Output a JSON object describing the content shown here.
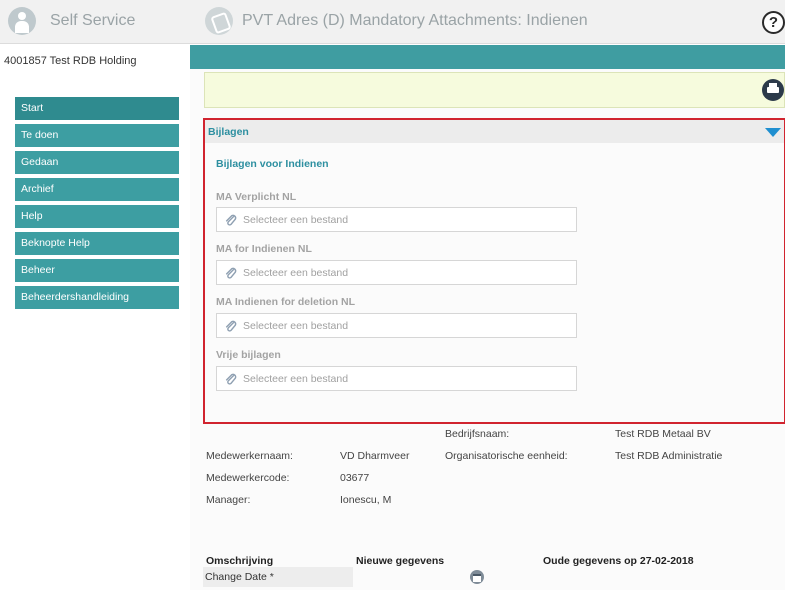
{
  "app": {
    "title": "Self Service",
    "page_title": "PVT Adres (D) Mandatory Attachments: Indienen",
    "help_label": "?"
  },
  "sidebar": {
    "company": "4001857 Test RDB Holding",
    "items": [
      {
        "label": "Start"
      },
      {
        "label": "Te doen"
      },
      {
        "label": "Gedaan"
      },
      {
        "label": "Archief"
      },
      {
        "label": "Help"
      },
      {
        "label": "Beknopte Help"
      },
      {
        "label": "Beheer"
      },
      {
        "label": "Beheerdershandleiding"
      }
    ]
  },
  "attachments": {
    "section_title": "Bijlagen",
    "subtitle": "Bijlagen voor Indienen",
    "fields": [
      {
        "label": "MA Verplicht NL",
        "placeholder": "Selecteer een bestand"
      },
      {
        "label": "MA for Indienen NL",
        "placeholder": "Selecteer een bestand"
      },
      {
        "label": "MA Indienen for deletion NL",
        "placeholder": "Selecteer een bestand"
      },
      {
        "label": "Vrije bijlagen",
        "placeholder": "Selecteer een bestand"
      }
    ]
  },
  "details": {
    "company_label": "Bedrijfsnaam:",
    "company_value": "Test RDB Metaal BV",
    "employee_name_label": "Medewerkernaam:",
    "employee_name_value": "VD Dharmveer",
    "org_unit_label": "Organisatorische eenheid:",
    "org_unit_value": "Test RDB Administratie",
    "employee_code_label": "Medewerkercode:",
    "employee_code_value": "03677",
    "manager_label": "Manager:",
    "manager_value": "Ionescu, M"
  },
  "changes": {
    "col_description": "Omschrijving",
    "col_new": "Nieuwe gegevens",
    "col_old": "Oude gegevens op 27-02-2018",
    "row_label": "Change Date *"
  }
}
